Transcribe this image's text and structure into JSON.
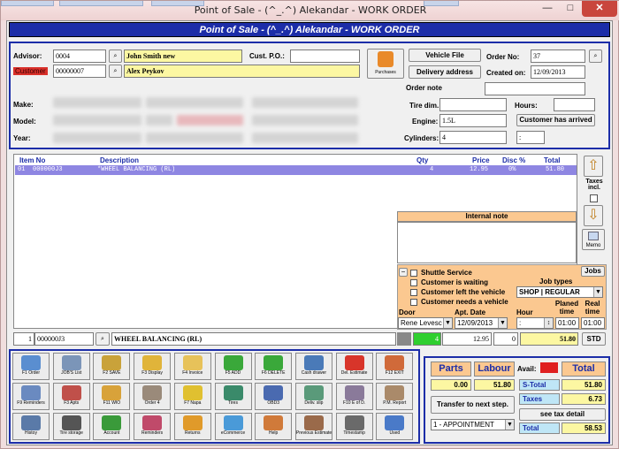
{
  "window": {
    "title": "Point of Sale - (^_.^) Alekandar - WORK ORDER",
    "minimize": "—",
    "maximize": "□",
    "close": "✕"
  },
  "header": {
    "title": "Point of Sale - (^_.^) Alekandar - WORK ORDER"
  },
  "customer": {
    "advisor_label": "Advisor:",
    "advisor_code": "0004",
    "advisor_name": "John Smith new",
    "customer_label": "Customer",
    "customer_code": "00000007",
    "customer_name": "Alex Peykov",
    "cust_po_label": "Cust. P.O.:",
    "cust_po_value": "",
    "purchases_label": "Purchases"
  },
  "order": {
    "vehicle_file": "Vehicle File",
    "delivery_address": "Delivery address",
    "order_no_label": "Order No:",
    "order_no": "37",
    "created_label": "Created on:",
    "created_on": "12/09/2013",
    "order_note_label": "Order note",
    "order_note": ""
  },
  "vehicle": {
    "make_label": "Make:",
    "model_label": "Model:",
    "year_label": "Year:",
    "tire_dim_label": "Tire dim.",
    "tire_dim": "",
    "hours_label": "Hours:",
    "hours": "",
    "engine_label": "Engine:",
    "engine": "1.5L",
    "cylinders_label": "Cylinders:",
    "cylinders": "4",
    "customer_arrived": "Customer has arrived",
    "colon_value": ":"
  },
  "grid": {
    "columns": [
      "Item No",
      "Description",
      "Qty",
      "Price",
      "Disc %",
      "Total"
    ],
    "rows": [
      {
        "num": "01",
        "item": "000000J3",
        "desc": "*WHEEL BALANCING (RL)",
        "qty": "4",
        "price": "12.95",
        "disc": "0%",
        "total": "51.80"
      }
    ]
  },
  "side": {
    "taxes_incl": "Taxes incl.",
    "memo": "Memo",
    "jobs": "Jobs"
  },
  "note": {
    "internal_note": "Internal note"
  },
  "options": {
    "shuttle": "Shuttle Service",
    "waiting": "Customer is waiting",
    "left_vehicle": "Customer left the vehicle",
    "needs_vehicle": "Customer needs a vehicle",
    "job_types_label": "Job types",
    "job_type": "SHOP | REGULAR",
    "door_label": "Door",
    "appt_date_label": "Apt. Date",
    "hour_label": "Hour",
    "planned_label": "Planed time",
    "real_label": "Real time",
    "door_value": "Rene Levesc",
    "appt_date": "12/09/2013",
    "hour_value": ":",
    "planned_time": "01:00",
    "real_time": "01:00"
  },
  "entry": {
    "line_no": "1",
    "item_no": "000000J3",
    "description": "WHEEL BALANCING (RL)",
    "qty": "4",
    "price": "12.95",
    "disc": "0",
    "total": "51.80",
    "std": "STD"
  },
  "toolbar": [
    {
      "label": "F1 Order",
      "icon": "order-icon",
      "color": "#5a8ed0"
    },
    {
      "label": "JOB'S List",
      "icon": "jobs-list-icon",
      "color": "#7b95b8"
    },
    {
      "label": "F2 SAVE",
      "icon": "save-icon",
      "color": "#c9a23a"
    },
    {
      "label": "F3 Display",
      "icon": "display-icon",
      "color": "#e0b43a"
    },
    {
      "label": "F4 Invoice",
      "icon": "invoice-icon",
      "color": "#e7c25a"
    },
    {
      "label": "F5 ADD",
      "icon": "add-icon",
      "color": "#3aa83a"
    },
    {
      "label": "F6 DELETE",
      "icon": "delete-icon",
      "color": "#3aa83a"
    },
    {
      "label": "Cash drawer",
      "icon": "cash-drawer-icon",
      "color": "#4a7ab8"
    },
    {
      "label": "Del. Estimate",
      "icon": "delete-estimate-icon",
      "color": "#d8352a"
    },
    {
      "label": "F12 EXIT",
      "icon": "exit-icon",
      "color": "#d06a3a"
    },
    {
      "label": "F9 Reminders",
      "icon": "reminders-icon",
      "color": "#6a8ac0"
    },
    {
      "label": "F3 Apts",
      "icon": "appointments-icon",
      "color": "#c0504a"
    },
    {
      "label": "F11 WIO",
      "icon": "wio-icon",
      "color": "#d8a23a"
    },
    {
      "label": "Order 4",
      "icon": "order4-icon",
      "color": "#9a8a7a"
    },
    {
      "label": "F7 Napa",
      "icon": "napa-icon",
      "color": "#e0c030"
    },
    {
      "label": "Tires",
      "icon": "tires-icon",
      "color": "#3a8a6a"
    },
    {
      "label": "OBD3",
      "icon": "obd3-icon",
      "color": "#4a6ab0"
    },
    {
      "label": "Deliv. slip",
      "icon": "delivery-slip-icon",
      "color": "#5a9a7a"
    },
    {
      "label": "F10 E of D.",
      "icon": "end-of-day-icon",
      "color": "#8a7a9a"
    },
    {
      "label": "P.M. Report",
      "icon": "pm-report-icon",
      "color": "#aa8a6a"
    },
    {
      "label": "Histoy",
      "icon": "history-icon",
      "color": "#5a7aa8"
    },
    {
      "label": "Tire storage",
      "icon": "tire-storage-icon",
      "color": "#555555"
    },
    {
      "label": "Account",
      "icon": "account-icon",
      "color": "#3a9a3a"
    },
    {
      "label": "Reminders",
      "icon": "reminders2-icon",
      "color": "#c04a6a"
    },
    {
      "label": "Returns",
      "icon": "returns-icon",
      "color": "#e09a2a"
    },
    {
      "label": "eCommerce",
      "icon": "ecommerce-icon",
      "color": "#4a9ad8"
    },
    {
      "label": "Help",
      "icon": "help-icon",
      "color": "#d07a3a"
    },
    {
      "label": "Previous Estimate",
      "icon": "previous-estimate-icon",
      "color": "#9a6a4a"
    },
    {
      "label": "Timestamp",
      "icon": "timestamp-icon",
      "color": "#6a6a6a"
    },
    {
      "label": "Used",
      "icon": "used-icon",
      "color": "#4a7ac8"
    }
  ],
  "totals": {
    "parts_label": "Parts",
    "labour_label": "Labour",
    "avail_label": "Avail:",
    "total_label": "Total",
    "parts": "0.00",
    "labour": "51.80",
    "stotal_label": "S-Total",
    "stotal": "51.80",
    "taxes_label": "Taxes",
    "taxes": "6.73",
    "transfer": "Transfer to next step.",
    "tax_detail": "see tax detail",
    "appointment": "1 - APPOINTMENT",
    "total2_label": "Total",
    "grand_total": "58.53"
  }
}
